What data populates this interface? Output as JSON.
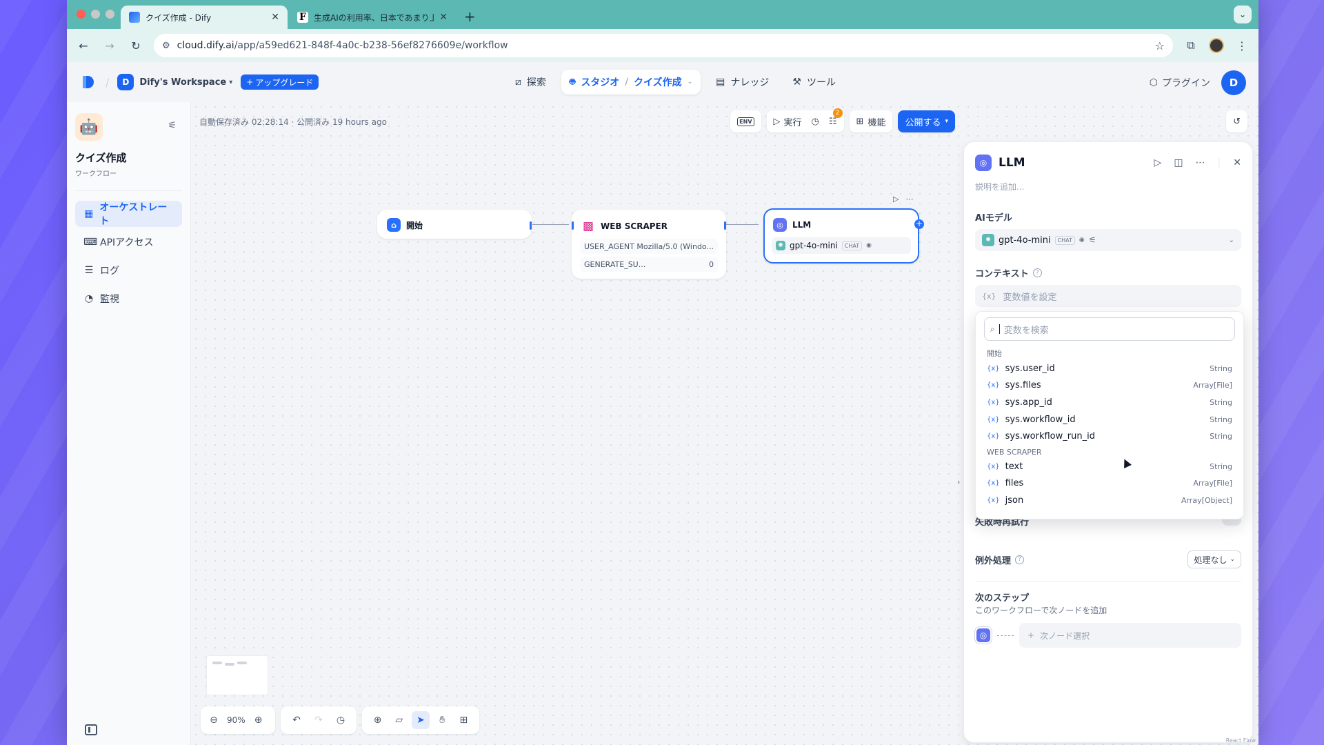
{
  "browser": {
    "tabs": [
      {
        "title": "クイズ作成 - Dify",
        "active": true,
        "favicon": "dify-icon"
      },
      {
        "title": "生成AIの利用率、日本であまり上",
        "active": false,
        "favicon": "forbes-icon"
      }
    ],
    "url_host": "cloud.dify.ai",
    "url_path": "/app/a59ed621-848f-4a0c-b238-56ef8276609e/workflow"
  },
  "header": {
    "workspace_initial": "D",
    "workspace_name": "Dify's Workspace",
    "upgrade_label": "アップグレード",
    "nav": {
      "explore": "探索",
      "studio": "スタジオ",
      "app_name": "クイズ作成",
      "knowledge": "ナレッジ",
      "tools": "ツール"
    },
    "plugins_label": "プラグイン",
    "user_initial": "D"
  },
  "sidebar": {
    "app_name": "クイズ作成",
    "app_type": "ワークフロー",
    "items": [
      {
        "label": "オーケストレート",
        "icon": "orchestrate-icon",
        "active": true
      },
      {
        "label": "APIアクセス",
        "icon": "api-icon",
        "active": false
      },
      {
        "label": "ログ",
        "icon": "log-icon",
        "active": false
      },
      {
        "label": "監視",
        "icon": "monitor-icon",
        "active": false
      }
    ]
  },
  "canvas": {
    "autosave": "自動保存済み 02:28:14 · 公開済み 19 hours ago",
    "actions": {
      "env": "ENV",
      "run": "実行",
      "checklist_count": "2",
      "features": "機能",
      "publish": "公開する"
    },
    "nodes": {
      "start": {
        "title": "開始"
      },
      "scraper": {
        "title": "WEB SCRAPER",
        "rows": [
          {
            "key": "USER_AGENT",
            "value": "Mozilla/5.0 (Windo..."
          },
          {
            "key": "GENERATE_SU...",
            "value": "0"
          }
        ]
      },
      "llm": {
        "title": "LLM",
        "model": "gpt-4o-mini",
        "mode": "CHAT"
      }
    },
    "zoom": "90%"
  },
  "panel": {
    "title": "LLM",
    "description_placeholder": "説明を追加...",
    "model_label": "AIモデル",
    "model_name": "gpt-4o-mini",
    "model_mode": "CHAT",
    "context_label": "コンテキスト",
    "context_placeholder": "変数値を設定",
    "dropdown": {
      "search_placeholder": "変数を検索",
      "groups": [
        {
          "name": "開始",
          "vars": [
            {
              "name": "sys.user_id",
              "type": "String"
            },
            {
              "name": "sys.files",
              "type": "Array[File]"
            },
            {
              "name": "sys.app_id",
              "type": "String"
            },
            {
              "name": "sys.workflow_id",
              "type": "String"
            },
            {
              "name": "sys.workflow_run_id",
              "type": "String"
            }
          ]
        },
        {
          "name": "WEB SCRAPER",
          "vars": [
            {
              "name": "text",
              "type": "String"
            },
            {
              "name": "files",
              "type": "Array[File]"
            },
            {
              "name": "json",
              "type": "Array[Object]"
            }
          ]
        }
      ]
    },
    "retry_label": "失敗時再試行",
    "exception_label": "例外処理",
    "exception_value": "処理なし",
    "next_step_title": "次のステップ",
    "next_step_sub": "このワークフローで次ノードを追加",
    "next_node_placeholder": "次ノード選択"
  },
  "attribution": "React Flow"
}
